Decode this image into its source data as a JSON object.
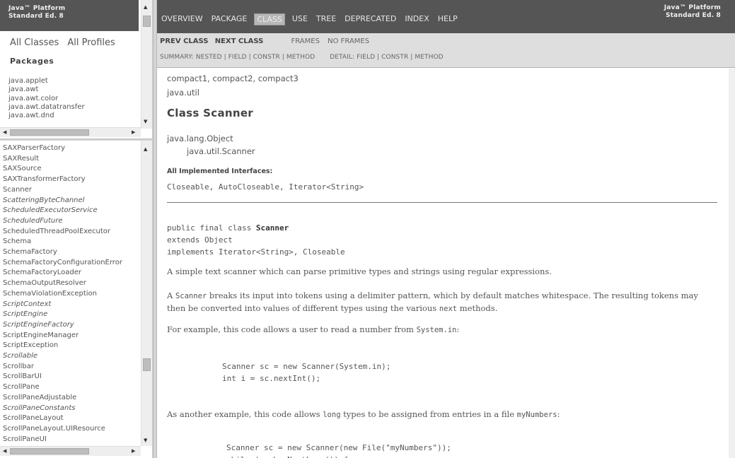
{
  "banner": {
    "line1": "Java™ Platform",
    "line2": "Standard Ed. 8"
  },
  "left": {
    "all_classes": "All Classes",
    "all_profiles": "All Profiles",
    "packages_heading": "Packages",
    "packages": [
      "java.applet",
      "java.awt",
      "java.awt.color",
      "java.awt.datatransfer",
      "java.awt.dnd"
    ],
    "classes": [
      {
        "name": "SAXParserFactory",
        "italic": false
      },
      {
        "name": "SAXResult",
        "italic": false
      },
      {
        "name": "SAXSource",
        "italic": false
      },
      {
        "name": "SAXTransformerFactory",
        "italic": false
      },
      {
        "name": "Scanner",
        "italic": false
      },
      {
        "name": "ScatteringByteChannel",
        "italic": true
      },
      {
        "name": "ScheduledExecutorService",
        "italic": true
      },
      {
        "name": "ScheduledFuture",
        "italic": true
      },
      {
        "name": "ScheduledThreadPoolExecutor",
        "italic": false
      },
      {
        "name": "Schema",
        "italic": false
      },
      {
        "name": "SchemaFactory",
        "italic": false
      },
      {
        "name": "SchemaFactoryConfigurationError",
        "italic": false
      },
      {
        "name": "SchemaFactoryLoader",
        "italic": false
      },
      {
        "name": "SchemaOutputResolver",
        "italic": false
      },
      {
        "name": "SchemaViolationException",
        "italic": false
      },
      {
        "name": "ScriptContext",
        "italic": true
      },
      {
        "name": "ScriptEngine",
        "italic": true
      },
      {
        "name": "ScriptEngineFactory",
        "italic": true
      },
      {
        "name": "ScriptEngineManager",
        "italic": false
      },
      {
        "name": "ScriptException",
        "italic": false
      },
      {
        "name": "Scrollable",
        "italic": true
      },
      {
        "name": "Scrollbar",
        "italic": false
      },
      {
        "name": "ScrollBarUI",
        "italic": false
      },
      {
        "name": "ScrollPane",
        "italic": false
      },
      {
        "name": "ScrollPaneAdjustable",
        "italic": false
      },
      {
        "name": "ScrollPaneConstants",
        "italic": true
      },
      {
        "name": "ScrollPaneLayout",
        "italic": false
      },
      {
        "name": "ScrollPaneLayout.UIResource",
        "italic": false
      },
      {
        "name": "ScrollPaneUI",
        "italic": false
      }
    ]
  },
  "nav": {
    "items": [
      {
        "label": "OVERVIEW",
        "active": false
      },
      {
        "label": "PACKAGE",
        "active": false
      },
      {
        "label": "CLASS",
        "active": true
      },
      {
        "label": "USE",
        "active": false
      },
      {
        "label": "TREE",
        "active": false
      },
      {
        "label": "DEPRECATED",
        "active": false
      },
      {
        "label": "INDEX",
        "active": false
      },
      {
        "label": "HELP",
        "active": false
      }
    ],
    "prev_class": "PREV CLASS",
    "next_class": "NEXT CLASS",
    "frames": "FRAMES",
    "no_frames": "NO FRAMES",
    "summary": "SUMMARY: NESTED | FIELD | CONSTR | METHOD",
    "detail": "DETAIL: FIELD | CONSTR | METHOD"
  },
  "content": {
    "profiles": "compact1, compact2, compact3",
    "package": "java.util",
    "title": "Class Scanner",
    "inherit_parent": "java.lang.Object",
    "inherit_child": "java.util.Scanner",
    "impl_label": "All Implemented Interfaces:",
    "impl_list": "Closeable, AutoCloseable, Iterator<String>",
    "decl_line1_prefix": "public final class ",
    "decl_line1_name": "Scanner",
    "decl_line2": "extends Object",
    "decl_line3": "implements Iterator<String>, Closeable",
    "p1": "A simple text scanner which can parse primitive types and strings using regular expressions.",
    "p2_a": "A ",
    "p2_code": "Scanner",
    "p2_b": " breaks its input into tokens using a delimiter pattern, which by default matches whitespace. The resulting tokens may then be converted into values of different types using the various ",
    "p2_code2": "next",
    "p2_c": " methods.",
    "p3_a": "For example, this code allows a user to read a number from ",
    "p3_code": "System.in",
    "p3_b": ":",
    "code1": "Scanner sc = new Scanner(System.in);\nint i = sc.nextInt();",
    "p4_a": "As another example, this code allows ",
    "p4_code": "long",
    "p4_b": " types to be assigned from entries in a file ",
    "p4_code2": "myNumbers",
    "p4_c": ":",
    "code2": "Scanner sc = new Scanner(new File(\"myNumbers\"));\nwhile (sc.hasNextLong()) {"
  }
}
